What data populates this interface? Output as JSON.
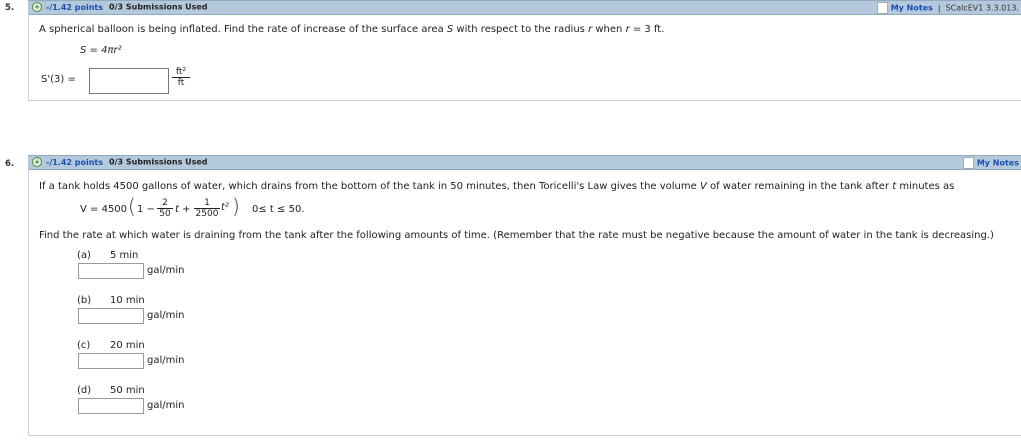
{
  "q5": {
    "number": "5.",
    "points": "-/1.42 points",
    "submissions": "0/3 Submissions Used",
    "my_notes": "My Notes",
    "separator": "|",
    "question_id": "SCalcEV1 3.3.013.",
    "prompt_a": "A spherical balloon is being inflated. Find the rate of increase of the surface area ",
    "prompt_var_s": "S",
    "prompt_b": " with respect to the radius ",
    "prompt_var_r": "r",
    "prompt_c": " when ",
    "prompt_var_r2": "r",
    "prompt_d": " = 3 ft.",
    "formula": "S = 4πr²",
    "answer_label": "S'(3) =",
    "unit_num": "ft²",
    "unit_den": "ft",
    "answer_value": ""
  },
  "q6": {
    "number": "6.",
    "points": "-/1.42 points",
    "submissions": "0/3 Submissions Used",
    "my_notes": "My Notes",
    "prompt_a": "If a tank holds 4500 gallons of water, which drains from the bottom of the tank in 50 minutes, then Toricelli's Law gives the volume ",
    "prompt_var_v": "V",
    "prompt_b": " of water remaining in the tank after ",
    "prompt_var_t": "t",
    "prompt_c": " minutes as",
    "formula_lhs": "V = 4500",
    "frac1_num": "2",
    "frac1_den": "50",
    "frac2_num": "1",
    "frac2_den": "2500",
    "formula_one": "1 −",
    "formula_t": "t +",
    "formula_t2": "t²",
    "domain": "0≤ t ≤ 50.",
    "instruction": "Find the rate at which water is draining from the tank after the following amounts of time. (Remember that the rate must be negative because the amount of water in the tank is decreasing.)",
    "parts": [
      {
        "label": "(a)",
        "time": "5 min",
        "unit": "gal/min",
        "value": ""
      },
      {
        "label": "(b)",
        "time": "10 min",
        "unit": "gal/min",
        "value": ""
      },
      {
        "label": "(c)",
        "time": "20 min",
        "unit": "gal/min",
        "value": ""
      },
      {
        "label": "(d)",
        "time": "50 min",
        "unit": "gal/min",
        "value": ""
      }
    ]
  },
  "colors": {
    "header_bg": "#b5c9dc",
    "link_blue": "#1a4fb0",
    "plus_green": "#2e7d32"
  }
}
